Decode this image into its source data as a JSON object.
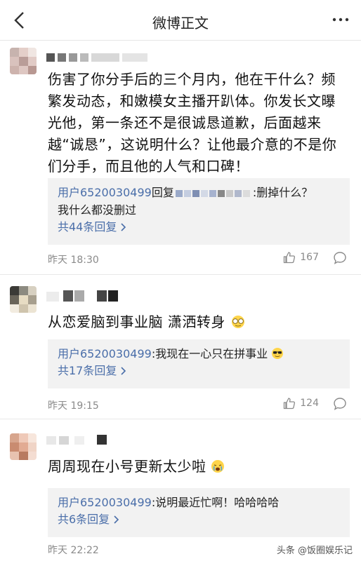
{
  "header": {
    "title": "微博正文"
  },
  "comments": [
    {
      "body": "伤害了你分手后的三个月内，他在干什么？频繁发动态，和嫩模女主播开趴体。你发长文曝光他，第一条还不是很诚恳道歉，后面越来越“诚恳”，这说明什么？让他最介意的不是你们分手，而且他的人气和口碑！",
      "reply": {
        "user": "用户6520030499",
        "action": "回复",
        "text_end": ":删掉什么？",
        "line2": "我什么都没删过",
        "more": "共44条回复"
      },
      "time": "昨天 18:30",
      "likes": "167"
    },
    {
      "body": "从恋爱脑到事业脑 潇洒转身",
      "reply": {
        "user": "用户6520030499",
        "text": ":我现在一心只在拼事业",
        "more": "共17条回复"
      },
      "time": "昨天 19:15",
      "likes": "124"
    },
    {
      "body": "周周现在小号更新太少啦",
      "reply": {
        "user": "用户6520030499",
        "text": ":说明最近忙啊！哈哈哈哈",
        "more": "共6条回复"
      },
      "time": "昨天 22:22"
    }
  ],
  "watermark": "头条 @饭圈娱乐记",
  "icons": {
    "back": "chevron-left-icon",
    "more": "more-dots-icon",
    "like": "thumbs-up-icon",
    "comment": "comment-bubble-icon"
  }
}
